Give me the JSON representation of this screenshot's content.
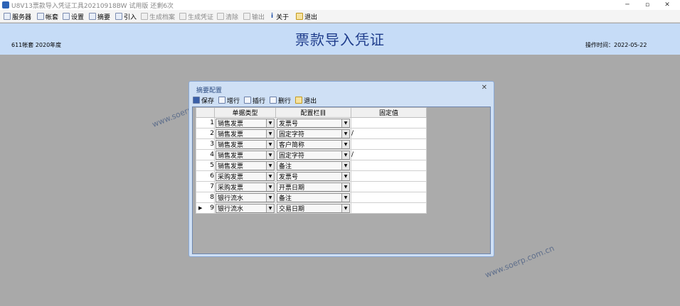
{
  "window": {
    "title": "U8V13票款导入凭证工具20210918BW 试用版 还剩6次",
    "minimize": "─",
    "restore": "▫",
    "close": "✕"
  },
  "menu": {
    "items": [
      {
        "label": "服务器",
        "enabled": true,
        "icon": "server-icon"
      },
      {
        "label": "帐套",
        "enabled": true,
        "icon": "account-set-icon"
      },
      {
        "label": "设置",
        "enabled": true,
        "icon": "settings-icon"
      },
      {
        "label": "摘要",
        "enabled": true,
        "icon": "summary-icon"
      },
      {
        "label": "引入",
        "enabled": true,
        "icon": "import-icon"
      },
      {
        "label": "生成档案",
        "enabled": false,
        "icon": "archive-icon"
      },
      {
        "label": "生成凭证",
        "enabled": false,
        "icon": "voucher-icon"
      },
      {
        "label": "清除",
        "enabled": false,
        "icon": "clear-icon"
      },
      {
        "label": "输出",
        "enabled": false,
        "icon": "export-icon"
      },
      {
        "label": "关于",
        "enabled": true,
        "icon": "info-icon"
      },
      {
        "label": "退出",
        "enabled": true,
        "icon": "exit-icon"
      }
    ]
  },
  "header": {
    "account": "611帐套 2020年度",
    "title": "票款导入凭证",
    "operation_time": "操作时间：2022-05-22"
  },
  "watermark": "www.soerp.com.cn",
  "dialog": {
    "title": "摘要配置",
    "close": "✕",
    "toolbar": {
      "save": "保存",
      "add_row": "增行",
      "insert_row": "插行",
      "delete_row": "删行",
      "exit": "退出"
    },
    "columns": [
      "单据类型",
      "配置栏目",
      "固定值"
    ],
    "rows": [
      {
        "no": "1",
        "doc_type": "销售发票",
        "field": "发票号",
        "fixed": ""
      },
      {
        "no": "2",
        "doc_type": "销售发票",
        "field": "固定字符",
        "fixed": "/"
      },
      {
        "no": "3",
        "doc_type": "销售发票",
        "field": "客户简称",
        "fixed": ""
      },
      {
        "no": "4",
        "doc_type": "销售发票",
        "field": "固定字符",
        "fixed": "/"
      },
      {
        "no": "5",
        "doc_type": "销售发票",
        "field": "备注",
        "fixed": ""
      },
      {
        "no": "6",
        "doc_type": "采购发票",
        "field": "发票号",
        "fixed": ""
      },
      {
        "no": "7",
        "doc_type": "采购发票",
        "field": "开票日期",
        "fixed": ""
      },
      {
        "no": "8",
        "doc_type": "银行流水",
        "field": "备注",
        "fixed": ""
      },
      {
        "no": "9",
        "doc_type": "银行流水",
        "field": "交易日期",
        "fixed": "",
        "current": true
      }
    ]
  }
}
